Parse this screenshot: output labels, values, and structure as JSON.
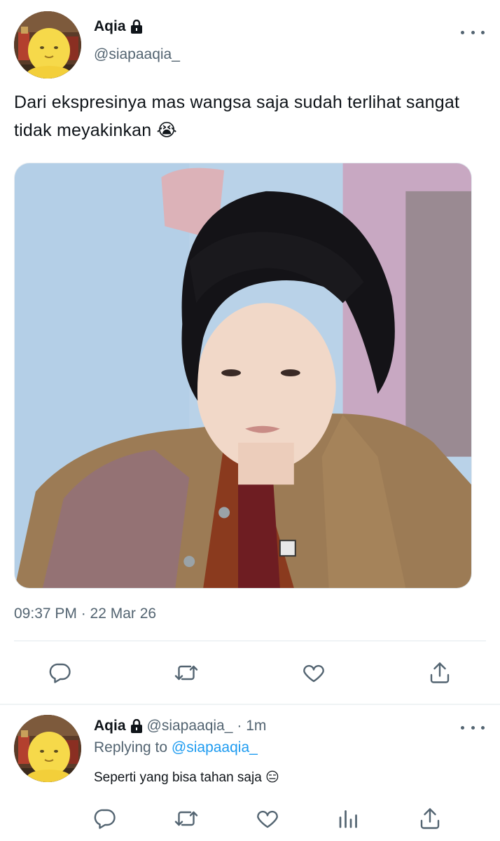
{
  "tweet": {
    "display_name": "Aqia",
    "handle": "@siapaaqia_",
    "text": "Dari ekspresinya mas wangsa saja sudah terlihat sangat tidak meyakinkan 😭",
    "timestamp": "09:37 PM · 22 Mar 26",
    "actions": {
      "reply": "reply-icon",
      "retweet": "retweet-icon",
      "like": "heart-icon",
      "share": "share-icon"
    }
  },
  "reply": {
    "display_name": "Aqia",
    "handle": "@siapaaqia_",
    "time": "· 1m",
    "replying_prefix": "Replying to",
    "replying_handle": "@siapaaqia_",
    "text": "Seperti yang bisa tahan saja 😑",
    "actions": {
      "reply": "reply-icon",
      "retweet": "retweet-icon",
      "like": "heart-icon",
      "views": "bar-chart-icon",
      "share": "share-icon"
    }
  },
  "colors": {
    "text": "#0f1419",
    "secondary": "#536471",
    "link": "#1d9bf0",
    "divider": "#e1e8ed"
  }
}
